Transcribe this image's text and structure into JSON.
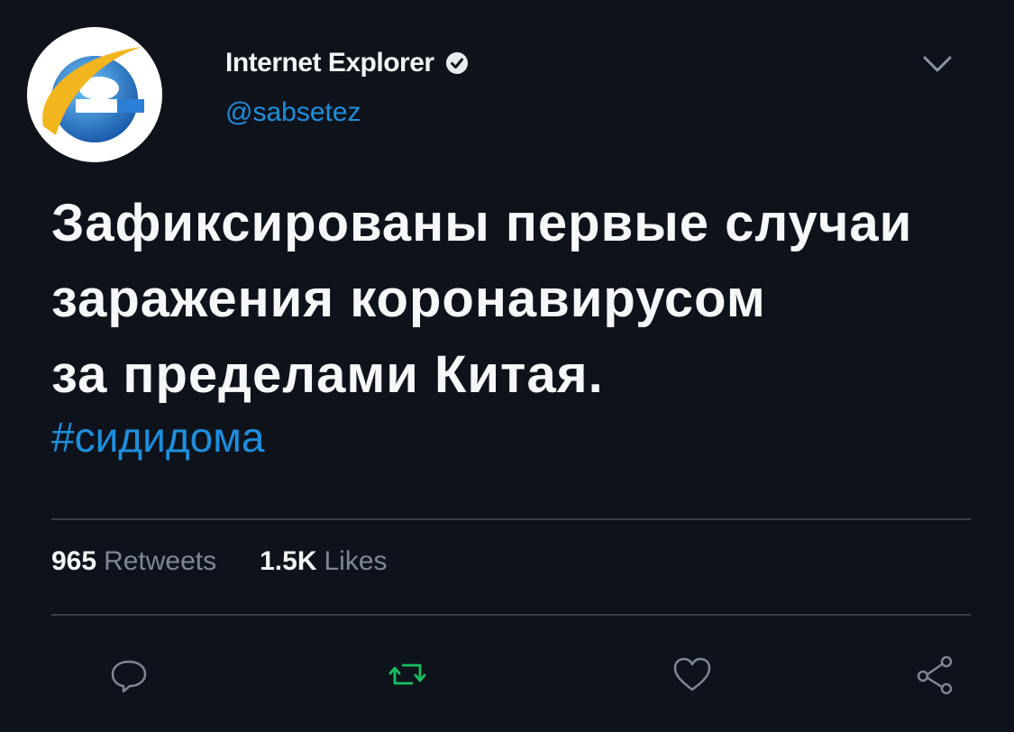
{
  "author": {
    "display_name": "Internet Explorer",
    "handle": "@sabsetez",
    "verified": true,
    "avatar_icon": "internet-explorer-logo"
  },
  "tweet": {
    "lines": [
      "Зафиксированы первые случаи",
      "заражения коронавирусом",
      "за пределами Китая."
    ],
    "hashtag": "#сидидома"
  },
  "stats": {
    "retweets_count": "965",
    "retweets_label": "Retweets",
    "likes_count": "1.5K",
    "likes_label": "Likes"
  },
  "actions": {
    "reply_icon": "reply-icon",
    "retweet_icon": "retweet-icon",
    "like_icon": "heart-icon",
    "share_icon": "share-icon"
  },
  "colors": {
    "background": "#0e131b",
    "accent": "#1d8fdf",
    "retweet_green": "#17bf63",
    "muted": "#7d8793"
  }
}
